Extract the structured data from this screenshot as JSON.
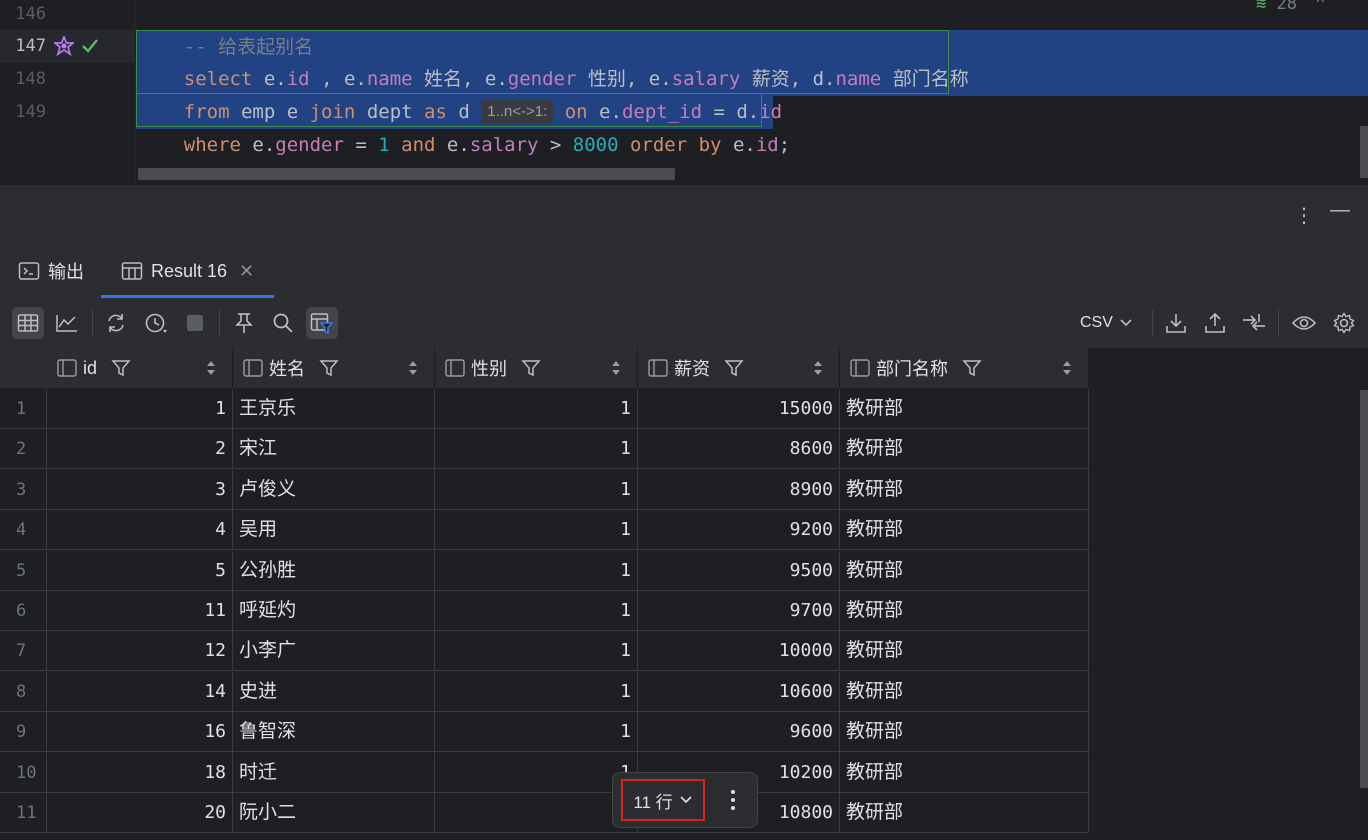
{
  "editor": {
    "top_right": "28",
    "lines": [
      {
        "no": "146"
      },
      {
        "no": "147"
      },
      {
        "no": "148"
      },
      {
        "no": "149"
      }
    ],
    "line146": {
      "comment": "-- 给表起别名"
    },
    "line147": {
      "t1": "select",
      "t2": " e.",
      "t3": "id",
      "t4": " , e.",
      "t5": "name",
      "t6": " 姓名, e.",
      "t7": "gender",
      "t8": " 性别, e.",
      "t9": "salary",
      "t10": " 薪资, d.",
      "t11": "name",
      "t12": " 部门名称"
    },
    "line148": {
      "t1": "from",
      "t2": " emp e ",
      "t3": "join",
      "t4": " dept ",
      "t5": "as",
      "t6": " d ",
      "hint": "1..n<->1:",
      "t7": " on",
      "t8": " e.",
      "t9": "dept_id",
      "t10": " = d.",
      "t11": "id"
    },
    "line149": {
      "t1": "where",
      "t2": " e.",
      "t3": "gender",
      "t4": " = ",
      "t5": "1",
      "t6": " and",
      "t7": " e.",
      "t8": "salary",
      "t9": " > ",
      "t10": "8000",
      "t11": " order by",
      "t12": " e.",
      "t13": "id",
      "t14": ";"
    }
  },
  "tabs": [
    {
      "label": "输出"
    },
    {
      "label": "Result 16"
    }
  ],
  "toolbar": {
    "export_format": "CSV"
  },
  "grid": {
    "columns": [
      {
        "label": "id"
      },
      {
        "label": "姓名"
      },
      {
        "label": "性别"
      },
      {
        "label": "薪资"
      },
      {
        "label": "部门名称"
      }
    ],
    "rows": [
      {
        "rn": "1",
        "id": "1",
        "name": "王京乐",
        "gender": "1",
        "salary": "15000",
        "dept": "教研部"
      },
      {
        "rn": "2",
        "id": "2",
        "name": "宋江",
        "gender": "1",
        "salary": "8600",
        "dept": "教研部"
      },
      {
        "rn": "3",
        "id": "3",
        "name": "卢俊义",
        "gender": "1",
        "salary": "8900",
        "dept": "教研部"
      },
      {
        "rn": "4",
        "id": "4",
        "name": "吴用",
        "gender": "1",
        "salary": "9200",
        "dept": "教研部"
      },
      {
        "rn": "5",
        "id": "5",
        "name": "公孙胜",
        "gender": "1",
        "salary": "9500",
        "dept": "教研部"
      },
      {
        "rn": "6",
        "id": "11",
        "name": "呼延灼",
        "gender": "1",
        "salary": "9700",
        "dept": "教研部"
      },
      {
        "rn": "7",
        "id": "12",
        "name": "小李广",
        "gender": "1",
        "salary": "10000",
        "dept": "教研部"
      },
      {
        "rn": "8",
        "id": "14",
        "name": "史进",
        "gender": "1",
        "salary": "10600",
        "dept": "教研部"
      },
      {
        "rn": "9",
        "id": "16",
        "name": "鲁智深",
        "gender": "1",
        "salary": "9600",
        "dept": "教研部"
      },
      {
        "rn": "10",
        "id": "18",
        "name": "时迁",
        "gender": "1",
        "salary": "10200",
        "dept": "教研部"
      },
      {
        "rn": "11",
        "id": "20",
        "name": "阮小二",
        "gender": "1",
        "salary": "10800",
        "dept": "教研部"
      }
    ]
  },
  "row_counter": {
    "label": "11 行"
  }
}
